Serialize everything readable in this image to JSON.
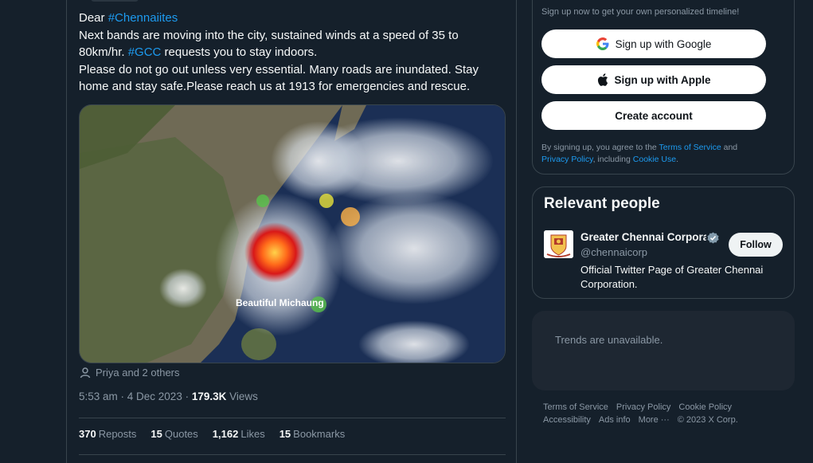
{
  "tweet": {
    "line1_prefix": "Dear ",
    "hashtag1": "#Chennaiites",
    "line2": "Next bands are moving into the city, sustained winds at a speed of 35 to 80km/hr. ",
    "hashtag2": "#GCC",
    "line2_suffix": " requests you to stay indoors.",
    "line3": "Please do not go out unless very essential. Many roads are inundated. Stay home and stay safe.Please reach us at 1913 for emergencies and rescue.",
    "image_caption": "Beautiful Michaung",
    "tagged": "Priya and 2 others",
    "timestamp": "5:53 am · 4 Dec 2023 · ",
    "views_count": "179.3K",
    "views_label": " Views",
    "stats": [
      {
        "num": "370",
        "label": "Reposts"
      },
      {
        "num": "15",
        "label": "Quotes"
      },
      {
        "num": "1,162",
        "label": "Likes"
      },
      {
        "num": "15",
        "label": "Bookmarks"
      }
    ]
  },
  "signup": {
    "hint": "Sign up now to get your own personalized timeline!",
    "google": "Sign up with Google",
    "apple": "Sign up with Apple",
    "create": "Create account",
    "legal_prefix": "By signing up, you agree to the ",
    "terms": "Terms of Service",
    "and": " and",
    "privacy": "Privacy Policy",
    "including": ", including ",
    "cookie": "Cookie Use",
    "period": "."
  },
  "people": {
    "title": "Relevant people",
    "name": "Greater Chennai Corpora",
    "handle": "@chennaicorp",
    "bio": "Official Twitter Page of Greater Chennai Corporation.",
    "follow": "Follow"
  },
  "trends": {
    "text": "Trends are unavailable."
  },
  "footer": {
    "row1": [
      "Terms of Service",
      "Privacy Policy",
      "Cookie Policy"
    ],
    "row2": [
      "Accessibility",
      "Ads info",
      "More ···",
      "© 2023 X Corp."
    ]
  },
  "colors": {
    "accent": "#1d9bf0",
    "background": "#15202b",
    "border": "#38444d"
  }
}
